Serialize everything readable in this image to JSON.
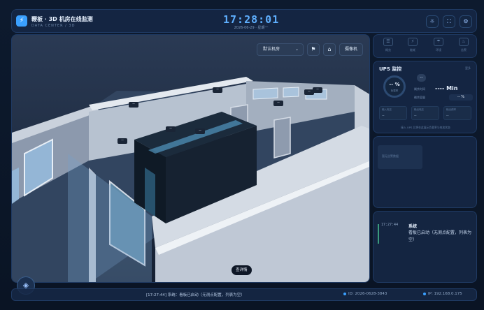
{
  "header": {
    "logo_glyph": "⚡",
    "title": "鞭板 · 3D 机房在线监测",
    "subtitle": "DATA CENTER / 3D",
    "time": "17:28:01",
    "date": "2026-06-29 · 星期一",
    "buttons": [
      {
        "name": "sun-icon",
        "glyph": "☼"
      },
      {
        "name": "fullscreen-icon",
        "glyph": "⛶"
      },
      {
        "name": "gear-icon",
        "glyph": "⚙"
      }
    ]
  },
  "viewport": {
    "room_select": "默认机房",
    "room_select_chevron": "⌄",
    "bookmark_glyph": "⚑",
    "home_glyph": "⌂",
    "camera_label": "摄像机",
    "detail_label": "查详情",
    "tags": [
      {
        "label": "--"
      },
      {
        "label": "--"
      },
      {
        "label": "--"
      },
      {
        "label": "--"
      },
      {
        "label": "--"
      },
      {
        "label": "--"
      },
      {
        "label": "--"
      },
      {
        "label": "--"
      }
    ],
    "layers_glyph": "◈"
  },
  "nav_tabs": [
    {
      "label": "概览",
      "glyph": "☰"
    },
    {
      "label": "能耗",
      "glyph": "⚡"
    },
    {
      "label": "环境",
      "glyph": "☂"
    },
    {
      "label": "告警",
      "glyph": "♨"
    }
  ],
  "ups": {
    "title": "UPS 监控",
    "more": "更多",
    "gauge_value": "-- %",
    "gauge_label": "负载率",
    "mini_value": "--",
    "runtime_label": "剩余时间",
    "runtime_value": "---- Min",
    "capacity_label": "剩余容量",
    "capacity_value": "-- %",
    "cells": [
      {
        "label": "输入电压",
        "value": "--"
      },
      {
        "label": "输出电压",
        "value": "--"
      },
      {
        "label": "输出频率",
        "value": "--"
      }
    ],
    "hint": "接入 UPS 后将在此展示负载率与电池状态"
  },
  "alarms": {
    "empty": "暂无告警数据"
  },
  "logs": [
    {
      "time": "17:27:44",
      "source": "系统",
      "message": "看板已启动（无测点配置，列表为空）"
    }
  ],
  "status": {
    "message": "[17:27:44] 系统：看板已启动（无测点配置，列表为空）",
    "id_text": "ID: 2026-0628-3843",
    "ip_text": "IP: 192.168.0.175",
    "id_color": "#3aa0ff",
    "ip_color": "#3aa0ff"
  }
}
